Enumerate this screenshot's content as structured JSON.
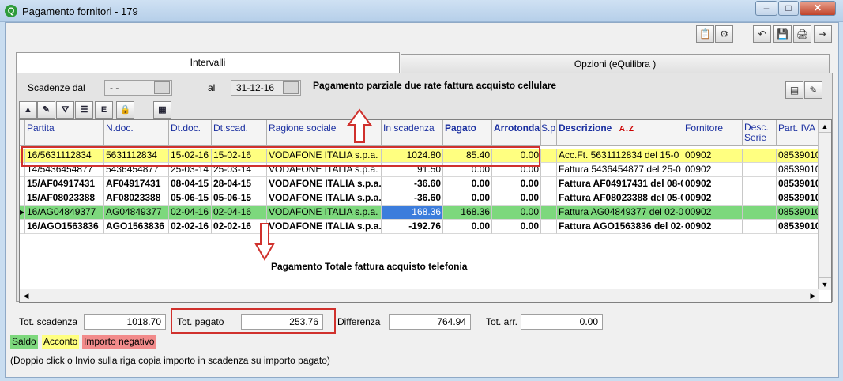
{
  "window": {
    "title": "Pagamento fornitori - 179",
    "app_icon": "Q",
    "minimize": "–",
    "maximize": "□",
    "close": "✕"
  },
  "toolbar_top": {
    "buttons": [
      "📋",
      "⚙",
      "↶",
      "💾",
      "🖨",
      "⇥"
    ]
  },
  "tabs": [
    {
      "label": "Intervalli",
      "active": true
    },
    {
      "label": "Opzioni (eQuilibra )",
      "active": false
    }
  ],
  "filter": {
    "from_label": "Scadenze dal",
    "from_value": "- -",
    "to_label": "al",
    "to_value": "31-12-16"
  },
  "annotations": {
    "top": "Pagamento parziale due rate fattura acquisto cellulare",
    "bottom": "Pagamento Totale fattura acquisto telefonia"
  },
  "grid_toolbar": [
    "▲",
    "✎",
    "⛛",
    "☰",
    "E",
    "🔒",
    "▦"
  ],
  "columns": [
    "Partita",
    "N.doc.",
    "Dt.doc.",
    "Dt.scad.",
    "Ragione sociale",
    "In scadenza",
    "Pagato",
    "Arrotondam",
    "S.p",
    "Descrizione",
    "Fornitore",
    "Desc. Serie",
    "Part. IVA"
  ],
  "rows": [
    {
      "partita": "16/5631112834",
      "ndoc": "5631112834",
      "dtdoc": "15-02-16",
      "dtscad": "15-02-16",
      "ragione": "VODAFONE ITALIA s.p.a.",
      "scadenza": "1024.80",
      "pagato": "85.40",
      "arrot": "0.00",
      "sp": "",
      "descr": "Acc.Ft. 5631112834 del 15-0",
      "fornitore": "00902",
      "serie": "",
      "piva": "08539010",
      "style": "acconto",
      "bold": false
    },
    {
      "partita": "14/5436454877",
      "ndoc": "5436454877",
      "dtdoc": "25-03-14",
      "dtscad": "25-03-14",
      "ragione": "VODAFONE ITALIA s.p.a.",
      "scadenza": "91.50",
      "pagato": "0.00",
      "arrot": "0.00",
      "sp": "",
      "descr": "Fattura 5436454877 del 25-0",
      "fornitore": "00902",
      "serie": "",
      "piva": "08539010",
      "style": "normal",
      "bold": false
    },
    {
      "partita": "15/AF04917431",
      "ndoc": "AF04917431",
      "dtdoc": "08-04-15",
      "dtscad": "28-04-15",
      "ragione": "VODAFONE ITALIA s.p.a.",
      "scadenza": "-36.60",
      "pagato": "0.00",
      "arrot": "0.00",
      "sp": "",
      "descr": "Fattura AF04917431 del 08-0",
      "fornitore": "00902",
      "serie": "",
      "piva": "08539010",
      "style": "normal",
      "bold": true
    },
    {
      "partita": "15/AF08023388",
      "ndoc": "AF08023388",
      "dtdoc": "05-06-15",
      "dtscad": "05-06-15",
      "ragione": "VODAFONE ITALIA s.p.a.",
      "scadenza": "-36.60",
      "pagato": "0.00",
      "arrot": "0.00",
      "sp": "",
      "descr": "Fattura AF08023388 del 05-0",
      "fornitore": "00902",
      "serie": "",
      "piva": "08539010",
      "style": "normal",
      "bold": true
    },
    {
      "partita": "16/AG04849377",
      "ndoc": "AG04849377",
      "dtdoc": "02-04-16",
      "dtscad": "02-04-16",
      "ragione": "VODAFONE ITALIA s.p.a.",
      "scadenza": "168.36",
      "pagato": "168.36",
      "arrot": "0.00",
      "sp": "",
      "descr": "Fattura AG04849377 del 02-0",
      "fornitore": "00902",
      "serie": "",
      "piva": "08539010",
      "style": "saldo",
      "bold": false
    },
    {
      "partita": "16/AGO1563836",
      "ndoc": "AGO1563836",
      "dtdoc": "02-02-16",
      "dtscad": "02-02-16",
      "ragione": "VODAFONE ITALIA s.p.a.",
      "scadenza": "-192.76",
      "pagato": "0.00",
      "arrot": "0.00",
      "sp": "",
      "descr": "Fattura AGO1563836 del 02-0",
      "fornitore": "00902",
      "serie": "",
      "piva": "08539010",
      "style": "normal",
      "bold": true
    }
  ],
  "totals": {
    "scadenza_label": "Tot. scadenza",
    "scadenza": "1018.70",
    "pagato_label": "Tot. pagato",
    "pagato": "253.76",
    "differenza_label": "Differenza",
    "differenza": "764.94",
    "arr_label": "Tot. arr.",
    "arr": "0.00"
  },
  "legend": [
    {
      "label": "Saldo",
      "color": "#7dd87d"
    },
    {
      "label": "Acconto",
      "color": "#ffff80"
    },
    {
      "label": "Importo negativo",
      "color": "#f28b8b"
    }
  ],
  "hint": "(Doppio click o Invio sulla riga copia importo in scadenza su importo pagato)",
  "colors": {
    "saldo": "#7dd87d",
    "acconto": "#ffff80",
    "negativo": "#f28b8b",
    "annotation_red": "#d0312d"
  }
}
